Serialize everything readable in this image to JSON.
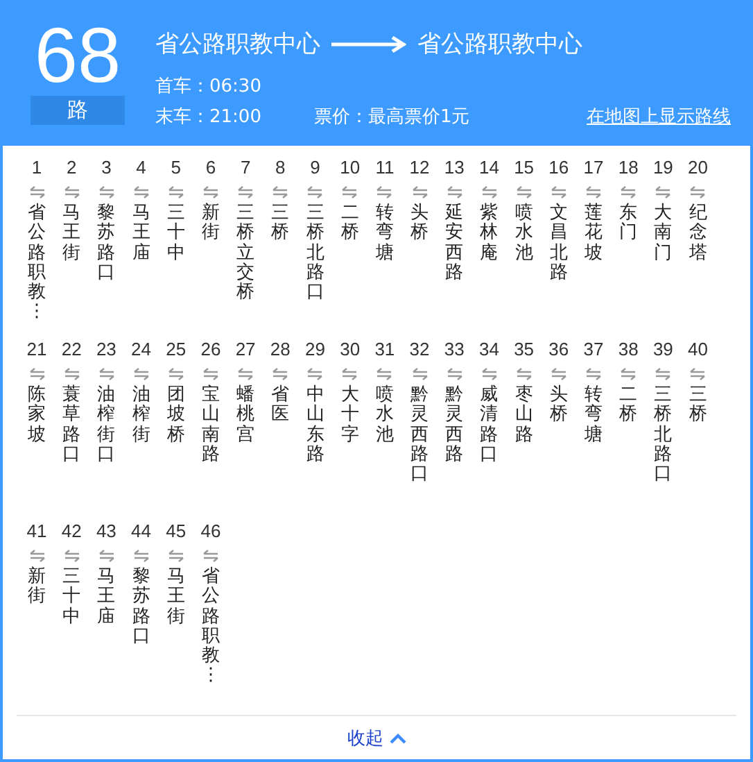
{
  "route": {
    "number": "68",
    "suffix": "路",
    "from": "省公路职教中心",
    "to": "省公路职教中心",
    "first_bus": "首车：06:30",
    "last_bus": "末车：21:00",
    "fare": "票价：最高票价1元",
    "map_link": "在地图上显示路线"
  },
  "stop_rows": [
    [
      {
        "index": "1",
        "name": [
          {
            "text": "省公路职教⋮",
            "highlighted": false
          }
        ]
      },
      {
        "index": "2",
        "name": [
          {
            "text": "马王街",
            "highlighted": false
          }
        ]
      },
      {
        "index": "3",
        "name": [
          {
            "text": "黎苏路口",
            "highlighted": false
          }
        ]
      },
      {
        "index": "4",
        "name": [
          {
            "text": "马王庙",
            "highlighted": false
          }
        ]
      },
      {
        "index": "5",
        "name": [
          {
            "text": "三十中",
            "highlighted": false
          }
        ]
      },
      {
        "index": "6",
        "name": [
          {
            "text": "新街",
            "highlighted": false
          }
        ]
      },
      {
        "index": "7",
        "name": [
          {
            "text": "三桥立交桥",
            "highlighted": false
          }
        ]
      },
      {
        "index": "8",
        "name": [
          {
            "text": "三桥",
            "highlighted": false
          }
        ]
      },
      {
        "index": "9",
        "name": [
          {
            "text": "三桥北路口",
            "highlighted": false
          }
        ]
      },
      {
        "index": "10",
        "name": [
          {
            "text": "二桥",
            "highlighted": false
          }
        ]
      },
      {
        "index": "11",
        "name": [
          {
            "text": "转弯塘",
            "highlighted": false
          }
        ]
      },
      {
        "index": "12",
        "name": [
          {
            "text": "头桥",
            "highlighted": false
          }
        ]
      },
      {
        "index": "13",
        "name": [
          {
            "text": "延安西路",
            "highlighted": false
          }
        ]
      },
      {
        "index": "14",
        "name": [
          {
            "text": "紫林庵",
            "highlighted": false
          }
        ]
      },
      {
        "index": "15",
        "name": [
          {
            "text": "喷水池",
            "highlighted": false
          }
        ]
      },
      {
        "index": "16",
        "name": [
          {
            "text": "文昌北路",
            "highlighted": false
          }
        ]
      },
      {
        "index": "17",
        "name": [
          {
            "text": "莲花坡",
            "highlighted": false
          }
        ]
      },
      {
        "index": "18",
        "name": [
          {
            "text": "东门",
            "highlighted": false
          }
        ]
      },
      {
        "index": "19",
        "name": [
          {
            "text": "大南门",
            "highlighted": false
          }
        ]
      },
      {
        "index": "20",
        "name": [
          {
            "text": "纪念塔",
            "highlighted": false
          }
        ]
      }
    ],
    [
      {
        "index": "21",
        "name": [
          {
            "text": "陈家坡",
            "highlighted": false
          }
        ]
      },
      {
        "index": "22",
        "name": [
          {
            "text": "蓑草路口",
            "highlighted": false
          }
        ]
      },
      {
        "index": "23",
        "name": [
          {
            "text": "油榨街口",
            "highlighted": false
          }
        ]
      },
      {
        "index": "24",
        "name": [
          {
            "text": "油榨街",
            "highlighted": false
          }
        ]
      },
      {
        "index": "25",
        "name": [
          {
            "text": "团坡桥",
            "highlighted": false
          }
        ]
      },
      {
        "index": "26",
        "name": [
          {
            "text": "宝山南路",
            "highlighted": false
          }
        ]
      },
      {
        "index": "27",
        "name": [
          {
            "text": "蟠桃宫",
            "highlighted": false
          }
        ]
      },
      {
        "index": "28",
        "name": [
          {
            "text": "省医",
            "highlighted": false
          }
        ]
      },
      {
        "index": "29",
        "name": [
          {
            "text": "中山东路",
            "highlighted": false
          }
        ]
      },
      {
        "index": "30",
        "name": [
          {
            "text": "大十字",
            "highlighted": false
          }
        ]
      },
      {
        "index": "31",
        "name": [
          {
            "text": "喷水池",
            "highlighted": false
          }
        ]
      },
      {
        "index": "32",
        "name": [
          {
            "text": "黔灵西路口",
            "highlighted": false
          }
        ]
      },
      {
        "index": "33",
        "name": [
          {
            "text": "黔灵西路",
            "highlighted": false
          }
        ]
      },
      {
        "index": "34",
        "name": [
          {
            "text": "威清路口",
            "highlighted": false
          }
        ]
      },
      {
        "index": "35",
        "name": [
          {
            "text": "枣山路",
            "highlighted": false
          }
        ]
      },
      {
        "index": "36",
        "name": [
          {
            "text": "头桥",
            "highlighted": false
          }
        ]
      },
      {
        "index": "37",
        "name": [
          {
            "text": "转弯塘",
            "highlighted": false
          }
        ]
      },
      {
        "index": "38",
        "name": [
          {
            "text": "二桥",
            "highlighted": false
          }
        ]
      },
      {
        "index": "39",
        "name": [
          {
            "text": "三桥北路口",
            "highlighted": false
          }
        ]
      },
      {
        "index": "40",
        "name": [
          {
            "text": "三桥",
            "highlighted": false
          }
        ]
      }
    ],
    [
      {
        "index": "41",
        "name": [
          {
            "text": "新街",
            "highlighted": false
          }
        ]
      },
      {
        "index": "42",
        "name": [
          {
            "text": "三十中",
            "highlighted": false
          }
        ]
      },
      {
        "index": "43",
        "name": [
          {
            "text": "马王庙",
            "highlighted": false
          }
        ]
      },
      {
        "index": "44",
        "name": [
          {
            "text": "黎苏路口",
            "highlighted": false
          }
        ]
      },
      {
        "index": "45",
        "name": [
          {
            "text": "马王街",
            "highlighted": false
          }
        ]
      },
      {
        "index": "46",
        "name": [
          {
            "text": "省公路职教⋮",
            "highlighted": false
          }
        ]
      }
    ]
  ],
  "collapse_button": "收起"
}
